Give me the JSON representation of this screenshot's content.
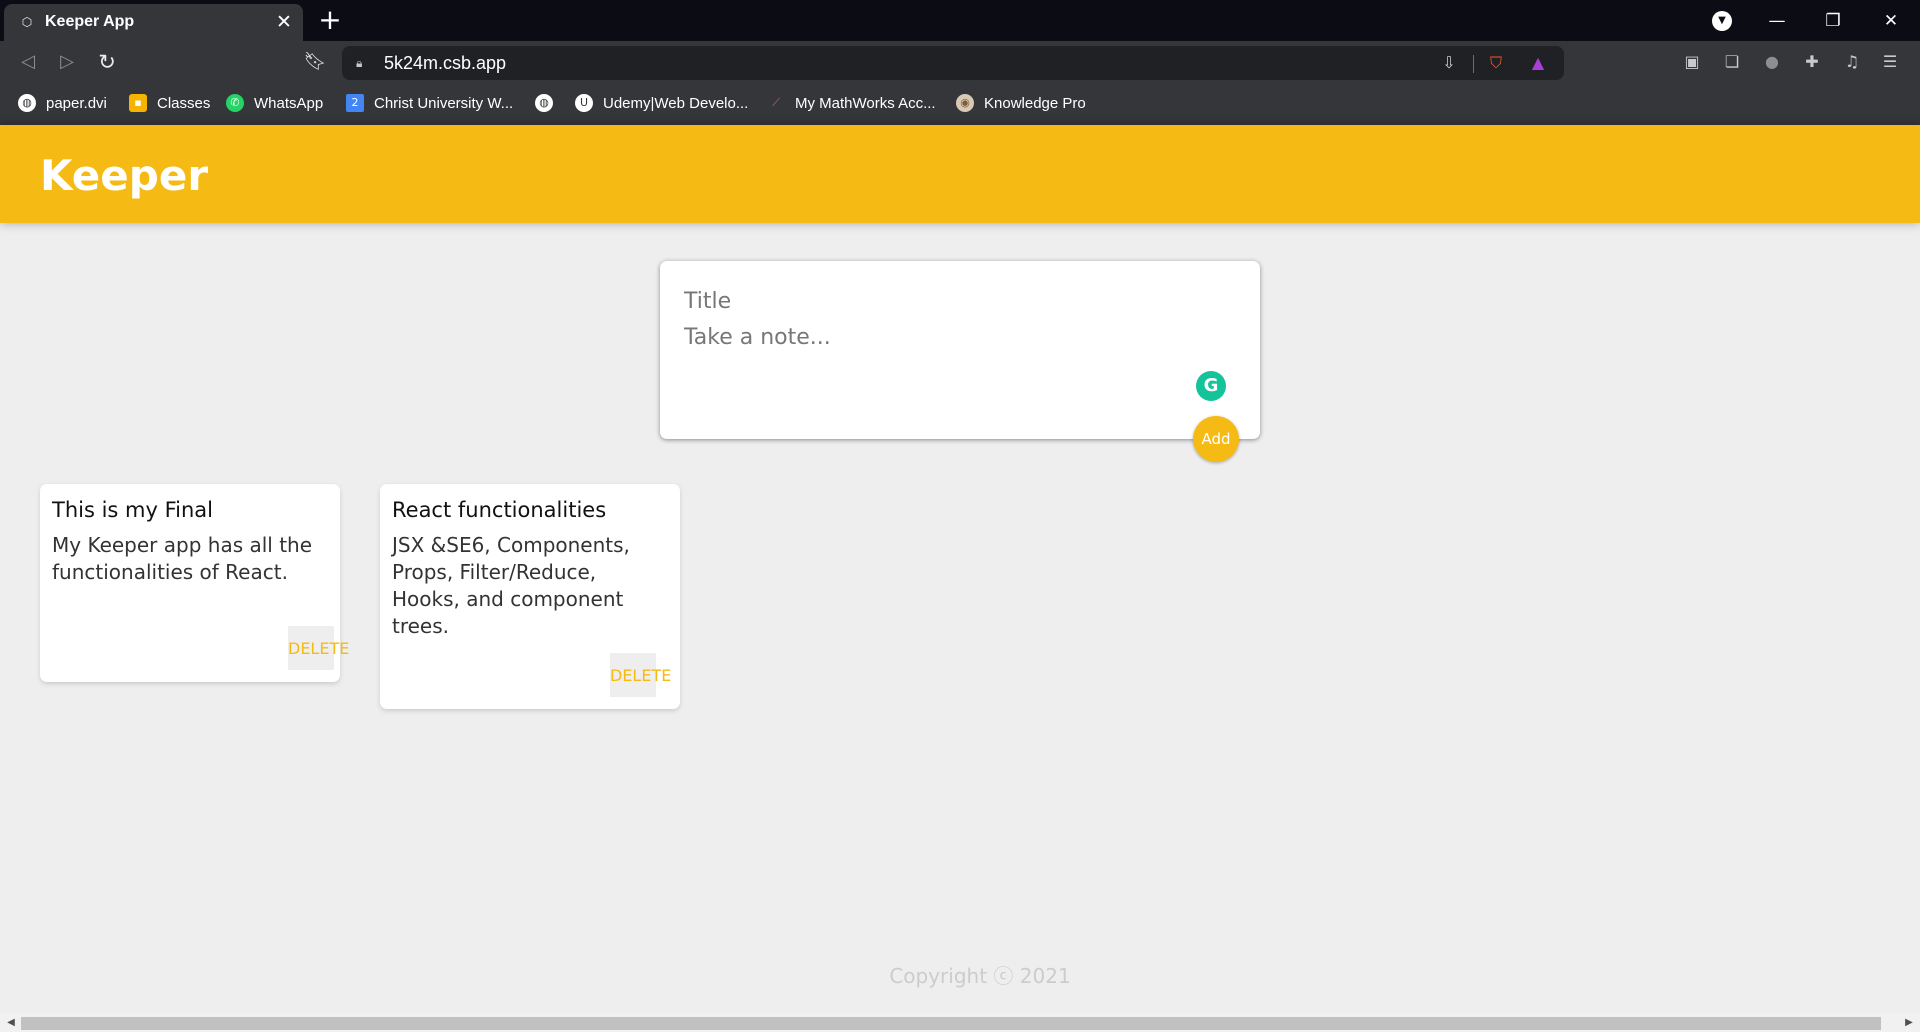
{
  "browser": {
    "tab": {
      "title": "Keeper App",
      "favicon": "codesandbox-icon",
      "close": "✕"
    },
    "new_tab": "+",
    "window_controls": {
      "minimize": "—",
      "restore": "❐",
      "close": "✕"
    },
    "url": "5k24m.csb.app",
    "bookmarks": [
      {
        "label": "paper.dvi",
        "icon": "globe-icon",
        "color": "#ffffff"
      },
      {
        "label": "Classes",
        "icon": "google-classroom-icon",
        "color": "#f6b400"
      },
      {
        "label": "WhatsApp",
        "icon": "whatsapp-icon",
        "color": "#25d366"
      },
      {
        "label": "Christ University W...",
        "icon": "calendar-icon",
        "color": "#4285f4"
      },
      {
        "label": "",
        "icon": "globe-icon",
        "color": "#ffffff"
      },
      {
        "label": "Udemy|Web Develo...",
        "icon": "udemy-icon",
        "color": "#ffffff"
      },
      {
        "label": "My MathWorks Acc...",
        "icon": "mathworks-icon",
        "color": "#e16737"
      },
      {
        "label": "Knowledge Pro",
        "icon": "knowledge-pro-icon",
        "color": "#d9c9b4"
      }
    ]
  },
  "app": {
    "logo": "Keeper",
    "create": {
      "title_placeholder": "Title",
      "content_placeholder": "Take a note...",
      "add_label": "Add"
    },
    "notes": [
      {
        "title": "This is my Final",
        "content": "My Keeper app has all the functionalities of React.",
        "delete_label": "DELETE"
      },
      {
        "title": "React functionalities",
        "content": "JSX &SE6, Components, Props, Filter/Reduce, Hooks, and component trees.",
        "delete_label": "DELETE"
      }
    ],
    "footer": "Copyright ⓒ 2021"
  },
  "colors": {
    "header": "#f5ba13",
    "accent": "#f5ba13",
    "page_bg": "#eeeeee",
    "grammarly": "#15c39a"
  }
}
